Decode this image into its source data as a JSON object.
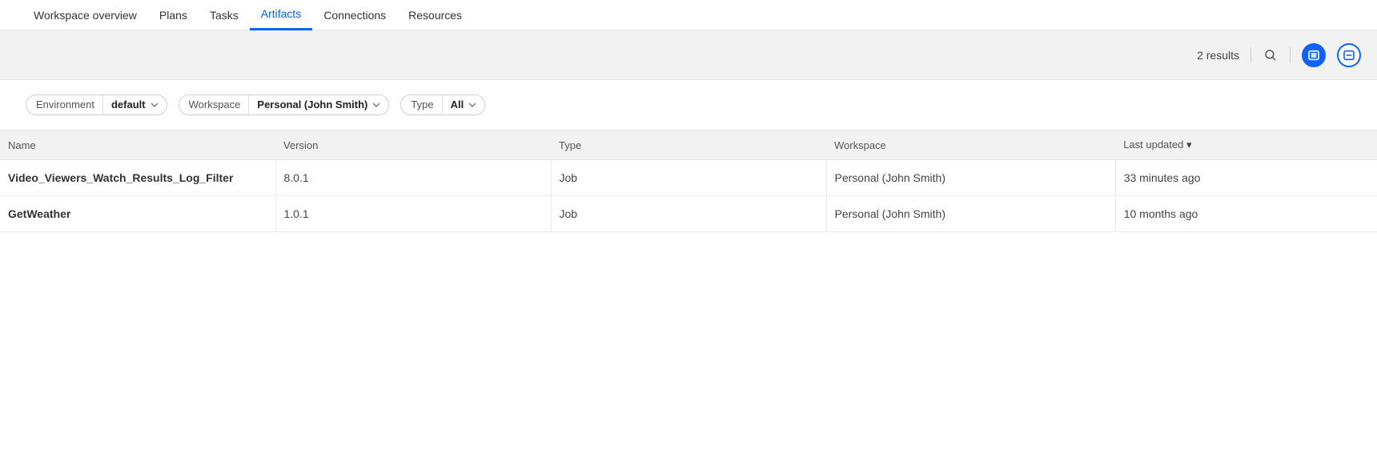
{
  "tabs": [
    {
      "label": "Workspace overview",
      "active": false
    },
    {
      "label": "Plans",
      "active": false
    },
    {
      "label": "Tasks",
      "active": false
    },
    {
      "label": "Artifacts",
      "active": true
    },
    {
      "label": "Connections",
      "active": false
    },
    {
      "label": "Resources",
      "active": false
    }
  ],
  "toolbar": {
    "results_text": "2 results"
  },
  "filters": {
    "environment": {
      "label": "Environment",
      "value": "default"
    },
    "workspace": {
      "label": "Workspace",
      "value": "Personal (John Smith)"
    },
    "type": {
      "label": "Type",
      "value": "All"
    }
  },
  "table": {
    "columns": {
      "name": "Name",
      "version": "Version",
      "type": "Type",
      "workspace": "Workspace",
      "last_updated": "Last updated"
    },
    "rows": [
      {
        "name": "Video_Viewers_Watch_Results_Log_Filter",
        "version": "8.0.1",
        "type": "Job",
        "workspace": "Personal (John Smith)",
        "last_updated": "33 minutes ago"
      },
      {
        "name": "GetWeather",
        "version": "1.0.1",
        "type": "Job",
        "workspace": "Personal (John Smith)",
        "last_updated": "10 months ago"
      }
    ]
  }
}
